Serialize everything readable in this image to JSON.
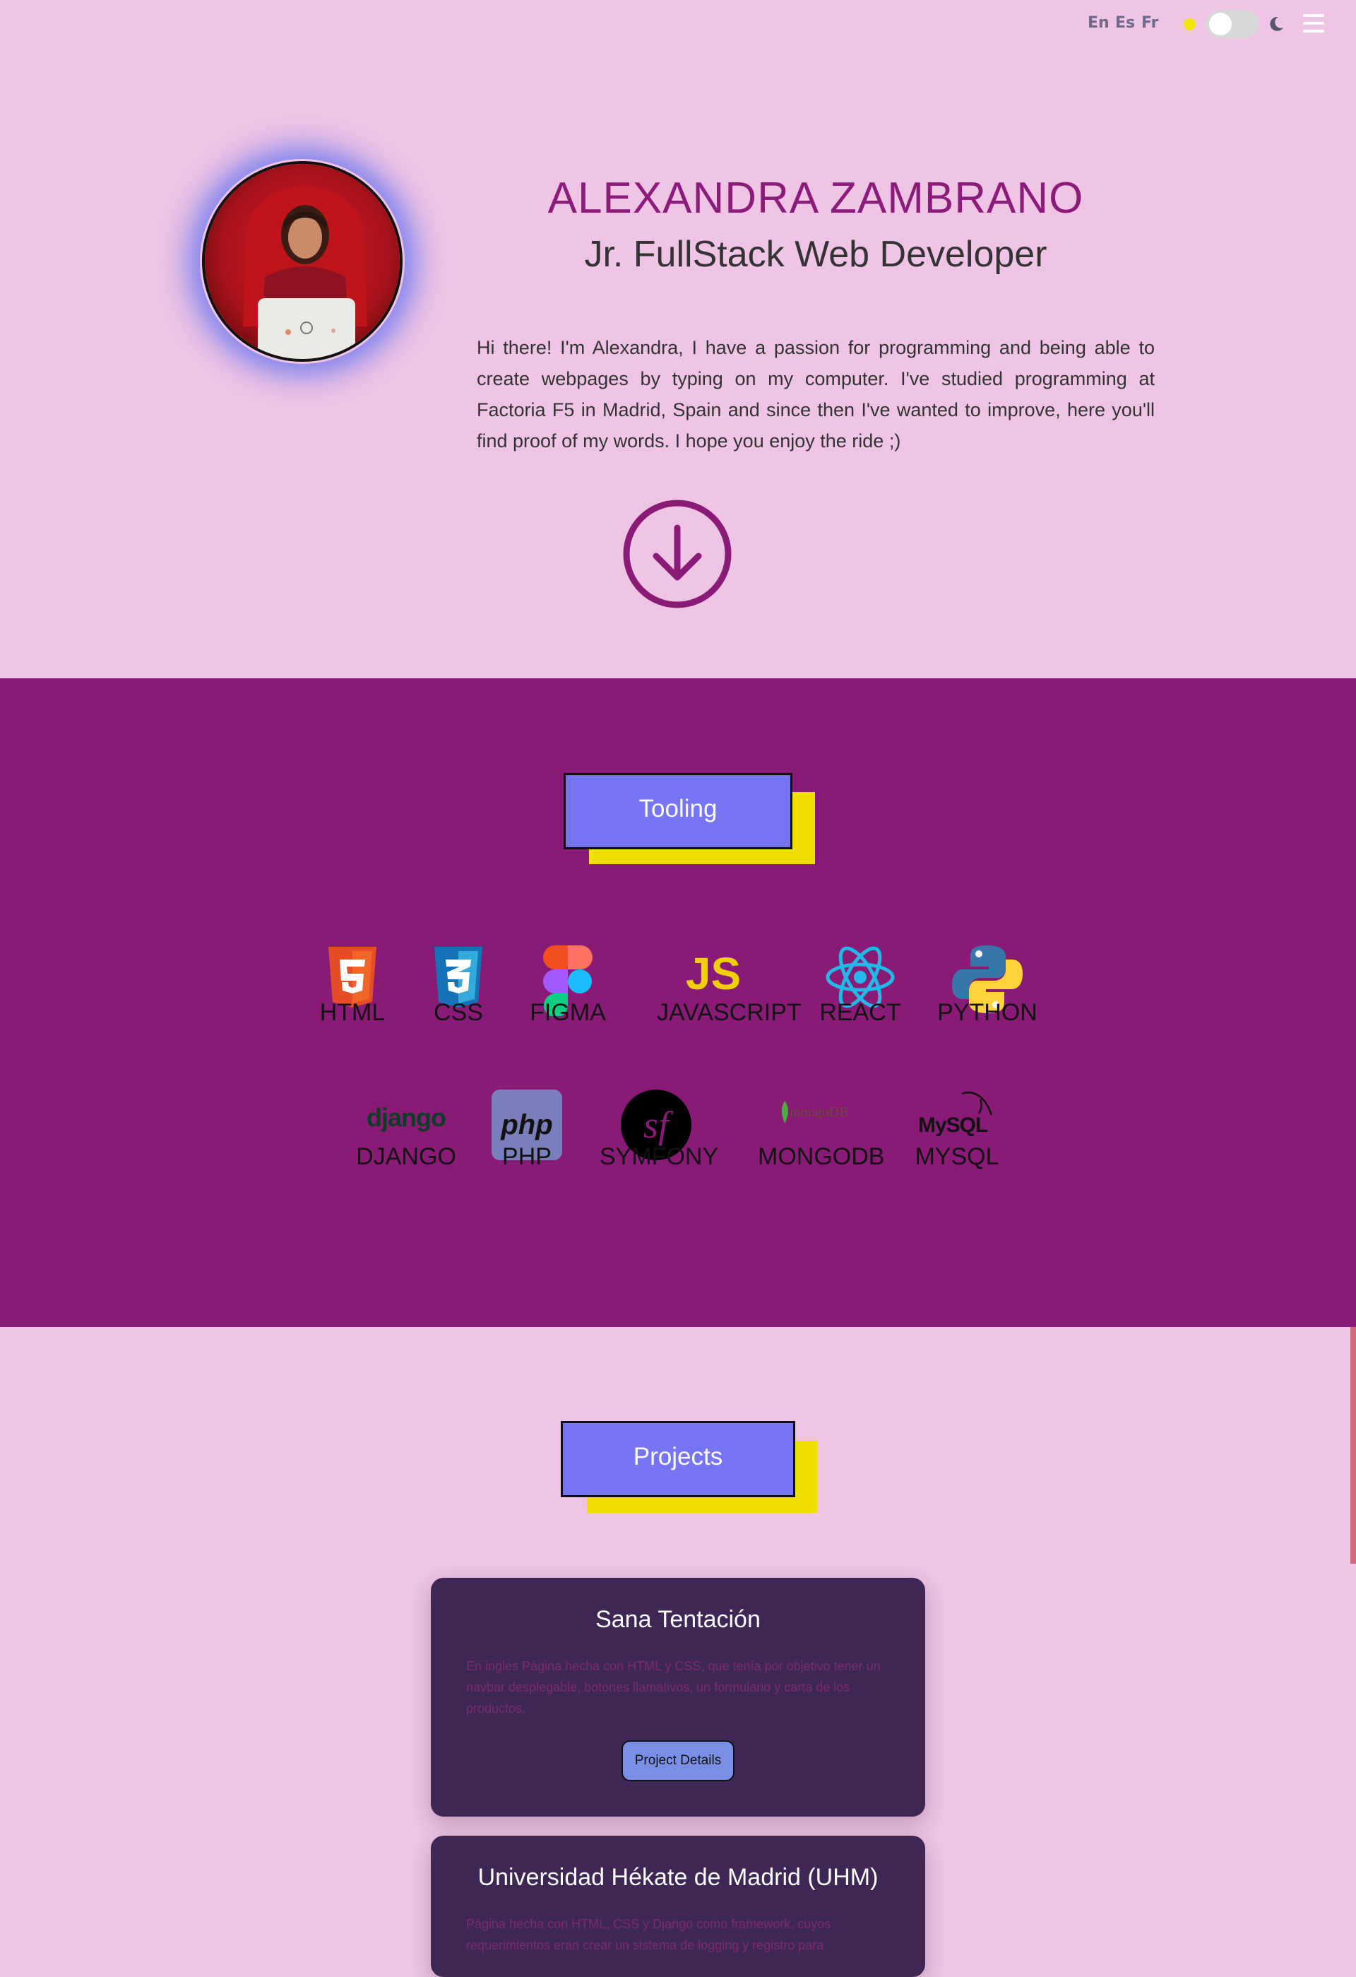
{
  "topbar": {
    "languages": [
      "En",
      "Es",
      "Fr"
    ],
    "theme_toggle": {
      "sun_icon": "sun-icon",
      "moon_icon": "moon-icon",
      "dark_mode": false
    },
    "menu_icon": "hamburger-icon"
  },
  "hero": {
    "name": "ALEXANDRA ZAMBRANO",
    "role": "Jr. FullStack Web Developer",
    "bio": "Hi there! I'm Alexandra, I have a passion for programming and being able to create webpages by typing on my computer. I've studied programming at Factoria F5 in Madrid, Spain and since then I've wanted to improve, here you'll find proof of my words. I hope you enjoy the ride ;)",
    "scroll_icon": "arrow-down-circle-icon"
  },
  "tooling": {
    "title": "Tooling",
    "row1": [
      {
        "label": "HTML",
        "icon": "html5-icon"
      },
      {
        "label": "CSS",
        "icon": "css3-icon"
      },
      {
        "label": "FIGMA",
        "icon": "figma-icon"
      },
      {
        "label": "JAVASCRIPT",
        "icon": "javascript-icon"
      },
      {
        "label": "REACT",
        "icon": "react-icon"
      },
      {
        "label": "PYTHON",
        "icon": "python-icon"
      }
    ],
    "row2": [
      {
        "label": "DJANGO",
        "icon": "django-icon",
        "logo_text": "django"
      },
      {
        "label": "PHP",
        "icon": "php-icon",
        "logo_text": "php"
      },
      {
        "label": "SYMFONY",
        "icon": "symfony-icon",
        "logo_text": "sf"
      },
      {
        "label": "MONGODB",
        "icon": "mongodb-icon",
        "logo_text": "mongoDB"
      },
      {
        "label": "MYSQL",
        "icon": "mysql-icon",
        "logo_text": "MySQL"
      }
    ],
    "js_logo_text": "JS"
  },
  "projects": {
    "title": "Projects",
    "items": [
      {
        "title": "Sana Tentación",
        "description": "En ingles Página hecha con HTML y CSS, que tenía por objetivo tener un navbar desplegable, botones llamativos, un formulario y carta de los productos.",
        "button": "Project Details"
      },
      {
        "title": "Universidad Hékate de Madrid (UHM)",
        "description": "Página hecha con HTML, CSS y Django como framework, cuyos requerimientos eran crear un sistema de logging y registro para"
      }
    ]
  },
  "colors": {
    "background": "#efc4e5",
    "accent": "#891b76",
    "title_box": "#7676f5",
    "title_shadow": "#f0e000",
    "card": "#3e2754"
  }
}
